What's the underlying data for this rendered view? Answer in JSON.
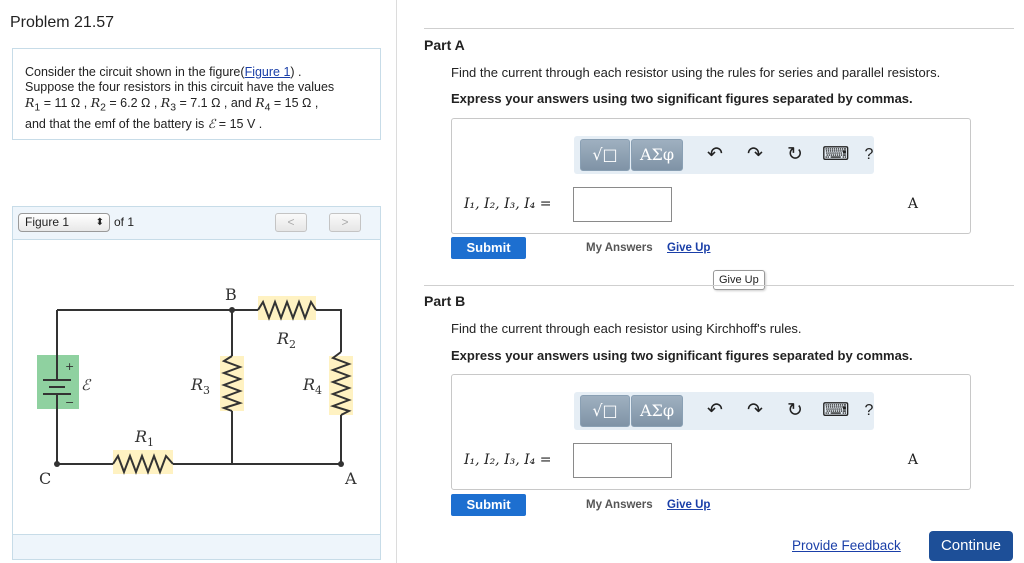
{
  "problem": {
    "title": "Problem 21.57",
    "line1_pre": "Consider the circuit shown in the figure(",
    "figure_link": "Figure 1",
    "line1_post": ") .",
    "line2": "Suppose the four resistors in this circuit have the values",
    "r1": "R",
    "r1_sub": "1",
    "r1_val": " = 11 Ω ,",
    "r2": "R",
    "r2_sub": "2",
    "r2_val": " = 6.2 Ω ,",
    "r3": "R",
    "r3_sub": "3",
    "r3_val": " = 7.1 Ω , and ",
    "r4": "R",
    "r4_sub": "4",
    "r4_val": " = 15 Ω ,",
    "line4_pre": "and that the emf of the battery is ",
    "emf_symbol": "ℰ",
    "emf_val": " = 15 V ."
  },
  "figure_panel": {
    "select_value": "Figure 1",
    "of_label": "of 1",
    "prev_label": "<",
    "next_label": ">",
    "labels": {
      "B": "B",
      "R2": "R",
      "R2_sub": "2",
      "R3": "R",
      "R3_sub": "3",
      "R4": "R",
      "R4_sub": "4",
      "R1": "R",
      "R1_sub": "1",
      "C": "C",
      "A": "A",
      "emf": "ℰ",
      "plus": "+",
      "minus": "−"
    }
  },
  "part_a": {
    "title": "Part A",
    "question": "Find the current through each resistor using the rules for series and parallel resistors.",
    "instruction": "Express your answers using two significant figures separated by commas.",
    "var_label": "I₁, I₂, I₃, I₄ =",
    "input_value": "",
    "unit": "A",
    "submit": "Submit",
    "my_answers": "My Answers",
    "give_up": "Give Up"
  },
  "tooltip": "Give Up",
  "part_b": {
    "title": "Part B",
    "question": "Find the current through each resistor using Kirchhoff's rules.",
    "instruction": "Express your answers using two significant figures separated by commas.",
    "var_label": "I₁, I₂, I₃, I₄ =",
    "input_value": "",
    "unit": "A",
    "submit": "Submit",
    "my_answers": "My Answers",
    "give_up": "Give Up"
  },
  "toolbar": {
    "templates_label": "√□",
    "symbols_label": "ΑΣφ",
    "undo_icon": "↶",
    "redo_icon": "↷",
    "reset_icon": "↻",
    "keyboard_icon": "⌨",
    "help_label": "?"
  },
  "footer": {
    "feedback": "Provide Feedback",
    "continue": "Continue"
  },
  "colors": {
    "link": "#1a3fa8",
    "submit": "#1d6fd0",
    "continue": "#1d4f98",
    "resistor_bg": "#fff2c2",
    "battery_bg": "#8fd1a0"
  }
}
